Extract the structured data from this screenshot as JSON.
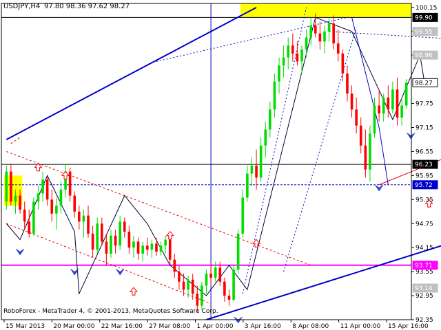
{
  "header": {
    "symbol": "USDJPY,H4",
    "ohlc": "97.80 98.36 97.62 98.27"
  },
  "footer": {
    "copyright": "RoboForex - MetaTrader 4, © 2001-2013, MetaQuotes Software Corp."
  },
  "colors": {
    "bull": "#00dd00",
    "bear": "#ff0000",
    "trend": "#0000cc",
    "magenta": "#ff00ff",
    "channel": "#ee0000",
    "yellow": "#ffff00",
    "grid": "#000000"
  },
  "chart_data": {
    "type": "candlestick",
    "title": "",
    "x_ticks": [
      "15 Mar 2013",
      "20 Mar 00:00",
      "22 Mar 16:00",
      "27 Mar 08:00",
      "1 Apr 00:00",
      "3 Apr 16:00",
      "8 Apr 08:00",
      "11 Apr 00:00",
      "15 Apr 16:00"
    ],
    "y_ticks": [
      100.15,
      99.55,
      98.96,
      97.75,
      97.15,
      96.55,
      95.95,
      95.35,
      94.75,
      94.15,
      93.55,
      92.95,
      92.35
    ],
    "ylim": [
      92.35,
      100.25
    ],
    "price_labels": [
      {
        "value": 99.9,
        "text": "99.90",
        "style": "black"
      },
      {
        "value": 99.55,
        "text": "99.55",
        "style": "gray"
      },
      {
        "value": 98.96,
        "text": "98.96",
        "style": "gray"
      },
      {
        "value": 98.27,
        "text": "98.27",
        "style": "white"
      },
      {
        "value": 96.23,
        "text": "96.23",
        "style": "black"
      },
      {
        "value": 95.72,
        "text": "95.72",
        "style": "blue"
      },
      {
        "value": 93.71,
        "text": "93.71",
        "style": "magenta"
      },
      {
        "value": 93.14,
        "text": "93.14",
        "style": "gray"
      }
    ],
    "horizontal_lines": [
      {
        "value": 99.9,
        "style": "solid"
      },
      {
        "value": 96.23,
        "style": "solid"
      },
      {
        "value": 95.72,
        "style": "dashed-blue"
      },
      {
        "value": 93.71,
        "style": "magenta"
      }
    ],
    "trend_lines": [
      {
        "from": [
          0,
          96.85
        ],
        "to": [
          55,
          100.15
        ],
        "style": "blue"
      },
      {
        "from": [
          44,
          92.35
        ],
        "to": [
          100,
          94.35
        ],
        "style": "blue"
      },
      {
        "from": [
          0,
          96.55
        ],
        "to": [
          67,
          93.71
        ],
        "style": "red-dashed"
      },
      {
        "from": [
          0,
          94.75
        ],
        "to": [
          45,
          92.75
        ],
        "style": "red-dashed"
      },
      {
        "from": [
          33,
          98.8
        ],
        "to": [
          75,
          99.9
        ],
        "style": "blue-dotted"
      },
      {
        "from": [
          71,
          99.55
        ],
        "to": [
          100,
          99.35
        ],
        "style": "navy-dotted"
      },
      {
        "from": [
          82,
          95.72
        ],
        "to": [
          100,
          96.55
        ],
        "style": "red"
      },
      {
        "from": [
          52,
          93.0
        ],
        "to": [
          66,
          100.15
        ],
        "style": "blue-dotted"
      },
      {
        "from": [
          61,
          93.55
        ],
        "to": [
          77,
          99.65
        ],
        "style": "blue-dotted"
      },
      {
        "from": [
          1,
          96.75
        ],
        "to": [
          3,
          96.9
        ],
        "style": "red-dashed"
      }
    ],
    "wave_lines": [
      {
        "points": [
          [
            0,
            94.75
          ],
          [
            3,
            94.35
          ],
          [
            9,
            95.95
          ],
          [
            15,
            94.55
          ],
          [
            16,
            93.0
          ],
          [
            26,
            95.45
          ],
          [
            31,
            94.75
          ],
          [
            36,
            93.71
          ],
          [
            44,
            92.95
          ],
          [
            49,
            93.71
          ],
          [
            53,
            93.1
          ],
          [
            68,
            99.9
          ],
          [
            76,
            99.55
          ],
          [
            85,
            97.35
          ],
          [
            91,
            98.96
          ],
          [
            92,
            98.27
          ]
        ],
        "style": "navy"
      },
      {
        "points": [
          [
            76,
            99.9
          ],
          [
            82,
            97.15
          ],
          [
            84,
            95.72
          ]
        ],
        "style": "blue"
      }
    ],
    "markers": [
      {
        "x": 7,
        "value": 96.15,
        "type": "up-arrow"
      },
      {
        "x": 13,
        "value": 95.95,
        "type": "up-arrow"
      },
      {
        "x": 28,
        "value": 93.05,
        "type": "up-arrow"
      },
      {
        "x": 36,
        "value": 94.45,
        "type": "up-arrow"
      },
      {
        "x": 55,
        "value": 94.25,
        "type": "up-arrow"
      },
      {
        "x": 93,
        "value": 95.25,
        "type": "up-arrow"
      },
      {
        "x": 3,
        "value": 94.05,
        "type": "chevron"
      },
      {
        "x": 15,
        "value": 93.55,
        "type": "chevron"
      },
      {
        "x": 25,
        "value": 93.55,
        "type": "chevron"
      },
      {
        "x": 51,
        "value": 92.35,
        "type": "chevron"
      },
      {
        "x": 82,
        "value": 95.65,
        "type": "chevron"
      },
      {
        "x": 89,
        "value": 96.95,
        "type": "chevron"
      }
    ],
    "rectangles": [
      {
        "x0": 52,
        "x1": 92,
        "y0": 99.9,
        "y1": 100.25,
        "color": "yellow"
      },
      {
        "x0": 0,
        "x1": 3,
        "y0": 95.2,
        "y1": 95.95,
        "color": "yellow"
      }
    ],
    "vertical_lines": [
      {
        "x": 45,
        "y0": 92.35,
        "y1": 100.25
      }
    ],
    "candles": [
      {
        "o": 95.3,
        "h": 96.2,
        "l": 95.1,
        "c": 96.05
      },
      {
        "o": 96.05,
        "h": 96.25,
        "l": 95.2,
        "c": 95.3
      },
      {
        "o": 95.3,
        "h": 95.6,
        "l": 95.0,
        "c": 95.45
      },
      {
        "o": 95.45,
        "h": 95.6,
        "l": 95.0,
        "c": 95.1
      },
      {
        "o": 95.1,
        "h": 95.3,
        "l": 94.6,
        "c": 94.8
      },
      {
        "o": 94.8,
        "h": 95.1,
        "l": 94.4,
        "c": 94.5
      },
      {
        "o": 94.5,
        "h": 95.4,
        "l": 94.45,
        "c": 95.3
      },
      {
        "o": 95.3,
        "h": 95.7,
        "l": 95.1,
        "c": 95.5
      },
      {
        "o": 95.5,
        "h": 96.05,
        "l": 95.3,
        "c": 95.85
      },
      {
        "o": 95.85,
        "h": 95.9,
        "l": 95.2,
        "c": 95.35
      },
      {
        "o": 95.35,
        "h": 95.6,
        "l": 94.8,
        "c": 95.0
      },
      {
        "o": 95.0,
        "h": 95.4,
        "l": 94.6,
        "c": 95.2
      },
      {
        "o": 95.2,
        "h": 95.8,
        "l": 95.0,
        "c": 95.6
      },
      {
        "o": 95.6,
        "h": 96.25,
        "l": 95.4,
        "c": 96.05
      },
      {
        "o": 96.05,
        "h": 96.15,
        "l": 95.3,
        "c": 95.45
      },
      {
        "o": 95.45,
        "h": 95.55,
        "l": 94.9,
        "c": 95.05
      },
      {
        "o": 95.05,
        "h": 95.2,
        "l": 94.6,
        "c": 94.8
      },
      {
        "o": 94.8,
        "h": 95.1,
        "l": 94.4,
        "c": 94.95
      },
      {
        "o": 94.95,
        "h": 95.2,
        "l": 94.4,
        "c": 94.5
      },
      {
        "o": 94.5,
        "h": 94.7,
        "l": 93.9,
        "c": 94.1
      },
      {
        "o": 94.1,
        "h": 94.9,
        "l": 94.0,
        "c": 94.75
      },
      {
        "o": 94.75,
        "h": 94.9,
        "l": 94.2,
        "c": 94.3
      },
      {
        "o": 94.3,
        "h": 94.5,
        "l": 93.7,
        "c": 94.0
      },
      {
        "o": 94.0,
        "h": 94.6,
        "l": 93.9,
        "c": 94.45
      },
      {
        "o": 94.45,
        "h": 94.6,
        "l": 94.0,
        "c": 94.2
      },
      {
        "o": 94.2,
        "h": 94.95,
        "l": 94.1,
        "c": 94.8
      },
      {
        "o": 94.8,
        "h": 94.9,
        "l": 94.4,
        "c": 94.55
      },
      {
        "o": 94.55,
        "h": 94.7,
        "l": 94.0,
        "c": 94.15
      },
      {
        "o": 94.15,
        "h": 94.45,
        "l": 93.9,
        "c": 94.3
      },
      {
        "o": 94.3,
        "h": 94.4,
        "l": 93.85,
        "c": 94.0
      },
      {
        "o": 94.0,
        "h": 94.3,
        "l": 93.8,
        "c": 94.2
      },
      {
        "o": 94.2,
        "h": 94.4,
        "l": 93.95,
        "c": 94.1
      },
      {
        "o": 94.1,
        "h": 94.35,
        "l": 93.9,
        "c": 94.25
      },
      {
        "o": 94.25,
        "h": 94.4,
        "l": 93.95,
        "c": 94.05
      },
      {
        "o": 94.05,
        "h": 94.3,
        "l": 93.95,
        "c": 94.2
      },
      {
        "o": 94.2,
        "h": 94.45,
        "l": 94.0,
        "c": 94.35
      },
      {
        "o": 94.35,
        "h": 94.4,
        "l": 93.7,
        "c": 93.85
      },
      {
        "o": 93.85,
        "h": 94.0,
        "l": 93.4,
        "c": 93.55
      },
      {
        "o": 93.55,
        "h": 93.7,
        "l": 93.1,
        "c": 93.3
      },
      {
        "o": 93.3,
        "h": 93.5,
        "l": 92.95,
        "c": 93.1
      },
      {
        "o": 93.1,
        "h": 93.45,
        "l": 92.9,
        "c": 93.35
      },
      {
        "o": 93.35,
        "h": 93.5,
        "l": 92.85,
        "c": 93.0
      },
      {
        "o": 93.0,
        "h": 93.2,
        "l": 92.55,
        "c": 92.7
      },
      {
        "o": 92.7,
        "h": 93.3,
        "l": 92.6,
        "c": 93.2
      },
      {
        "o": 93.2,
        "h": 93.6,
        "l": 93.0,
        "c": 93.5
      },
      {
        "o": 93.5,
        "h": 93.75,
        "l": 93.2,
        "c": 93.4
      },
      {
        "o": 93.4,
        "h": 93.8,
        "l": 93.3,
        "c": 93.65
      },
      {
        "o": 93.65,
        "h": 93.8,
        "l": 93.2,
        "c": 93.3
      },
      {
        "o": 93.3,
        "h": 93.4,
        "l": 92.8,
        "c": 92.95
      },
      {
        "o": 92.95,
        "h": 93.1,
        "l": 92.7,
        "c": 92.85
      },
      {
        "o": 92.85,
        "h": 93.7,
        "l": 92.8,
        "c": 93.6
      },
      {
        "o": 93.6,
        "h": 94.6,
        "l": 93.5,
        "c": 94.5
      },
      {
        "o": 94.5,
        "h": 95.6,
        "l": 94.4,
        "c": 95.4
      },
      {
        "o": 95.4,
        "h": 96.2,
        "l": 95.3,
        "c": 96.0
      },
      {
        "o": 96.0,
        "h": 96.4,
        "l": 95.7,
        "c": 96.2
      },
      {
        "o": 96.2,
        "h": 96.6,
        "l": 95.6,
        "c": 95.9
      },
      {
        "o": 95.9,
        "h": 96.9,
        "l": 95.8,
        "c": 96.7
      },
      {
        "o": 96.7,
        "h": 97.3,
        "l": 96.4,
        "c": 97.1
      },
      {
        "o": 97.1,
        "h": 97.8,
        "l": 96.9,
        "c": 97.6
      },
      {
        "o": 97.6,
        "h": 98.5,
        "l": 97.4,
        "c": 98.3
      },
      {
        "o": 98.3,
        "h": 98.9,
        "l": 98.0,
        "c": 98.7
      },
      {
        "o": 98.7,
        "h": 99.2,
        "l": 98.4,
        "c": 98.9
      },
      {
        "o": 98.9,
        "h": 99.4,
        "l": 98.6,
        "c": 99.2
      },
      {
        "o": 99.2,
        "h": 99.5,
        "l": 98.8,
        "c": 99.0
      },
      {
        "o": 99.0,
        "h": 99.3,
        "l": 98.7,
        "c": 98.8
      },
      {
        "o": 98.8,
        "h": 99.2,
        "l": 98.5,
        "c": 99.1
      },
      {
        "o": 99.1,
        "h": 99.6,
        "l": 98.9,
        "c": 99.4
      },
      {
        "o": 99.4,
        "h": 99.9,
        "l": 99.2,
        "c": 99.7
      },
      {
        "o": 99.7,
        "h": 100.0,
        "l": 99.4,
        "c": 99.5
      },
      {
        "o": 99.5,
        "h": 99.8,
        "l": 99.1,
        "c": 99.3
      },
      {
        "o": 99.3,
        "h": 99.7,
        "l": 99.0,
        "c": 99.55
      },
      {
        "o": 99.55,
        "h": 99.9,
        "l": 99.3,
        "c": 99.75
      },
      {
        "o": 99.75,
        "h": 99.95,
        "l": 99.1,
        "c": 99.25
      },
      {
        "o": 99.25,
        "h": 99.6,
        "l": 98.8,
        "c": 99.0
      },
      {
        "o": 99.0,
        "h": 99.1,
        "l": 98.3,
        "c": 98.5
      },
      {
        "o": 98.5,
        "h": 98.7,
        "l": 97.8,
        "c": 98.0
      },
      {
        "o": 98.0,
        "h": 98.2,
        "l": 97.4,
        "c": 97.6
      },
      {
        "o": 97.6,
        "h": 97.9,
        "l": 97.0,
        "c": 97.2
      },
      {
        "o": 97.2,
        "h": 97.4,
        "l": 96.5,
        "c": 96.7
      },
      {
        "o": 96.7,
        "h": 97.1,
        "l": 95.9,
        "c": 96.1
      },
      {
        "o": 96.1,
        "h": 97.2,
        "l": 95.8,
        "c": 97.0
      },
      {
        "o": 97.0,
        "h": 97.9,
        "l": 96.9,
        "c": 97.7
      },
      {
        "o": 97.7,
        "h": 98.1,
        "l": 97.3,
        "c": 97.5
      },
      {
        "o": 97.5,
        "h": 98.0,
        "l": 97.3,
        "c": 97.9
      },
      {
        "o": 97.9,
        "h": 98.2,
        "l": 97.4,
        "c": 97.6
      },
      {
        "o": 97.6,
        "h": 98.3,
        "l": 97.5,
        "c": 98.1
      },
      {
        "o": 98.1,
        "h": 98.4,
        "l": 97.2,
        "c": 97.4
      },
      {
        "o": 97.4,
        "h": 97.9,
        "l": 97.2,
        "c": 97.7
      },
      {
        "o": 97.7,
        "h": 98.36,
        "l": 97.62,
        "c": 98.27
      }
    ]
  }
}
